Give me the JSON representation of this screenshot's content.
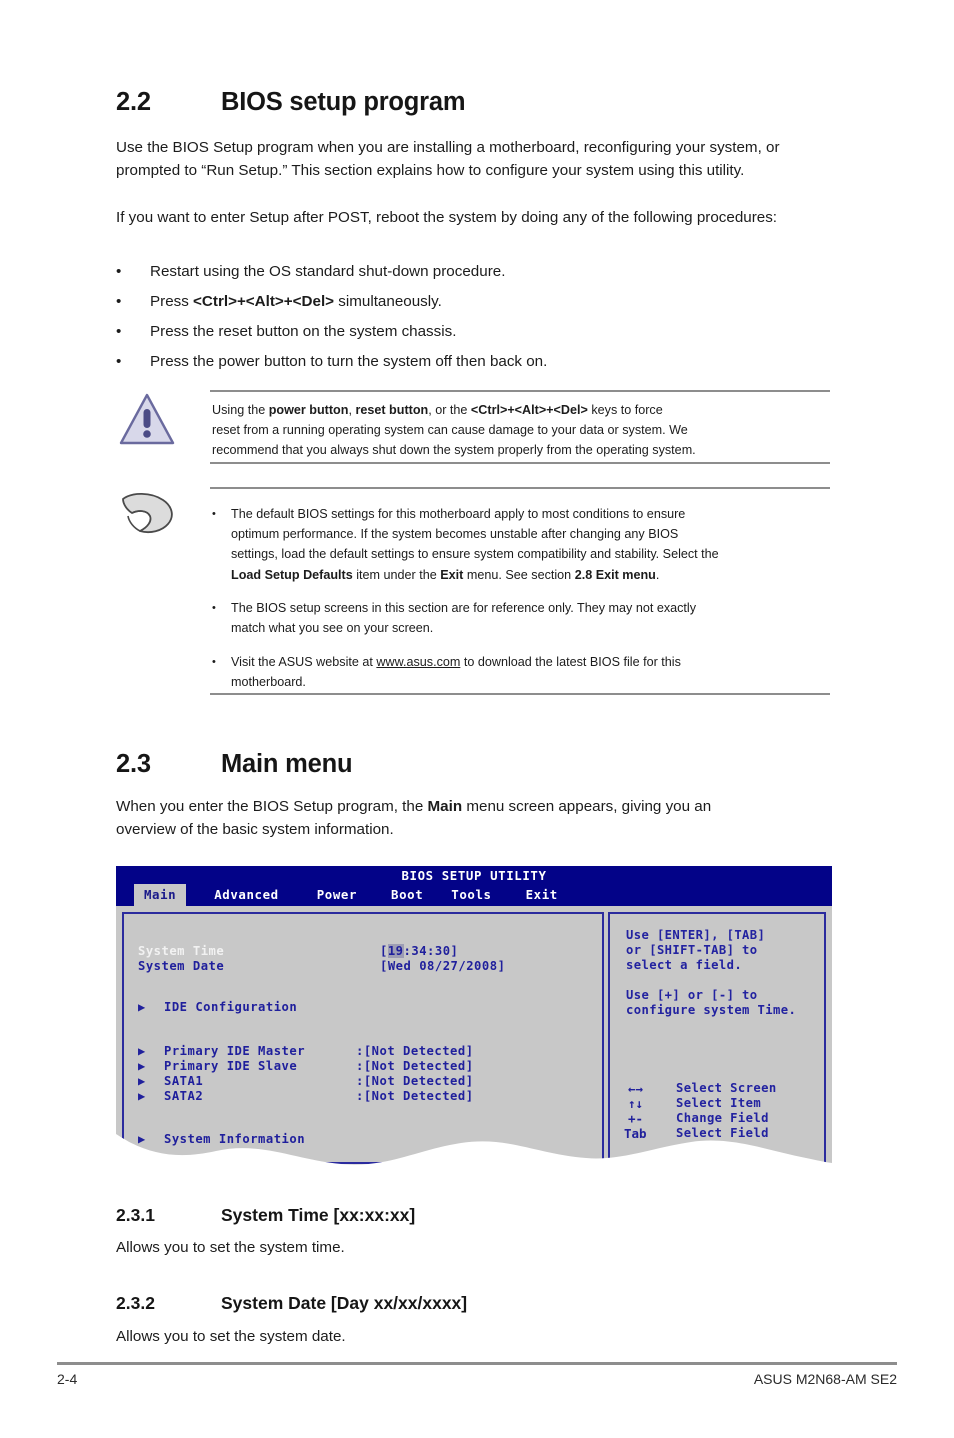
{
  "section_22": {
    "number": "2.2",
    "title": "BIOS setup program",
    "para1": "Use the BIOS Setup program when you are installing a motherboard, reconfiguring your system, or prompted to “Run Setup.” This section explains how to configure your system using this utility.",
    "para2": "If you want to enter Setup after POST, reboot the system by doing any of the following procedures:",
    "bullet_marker": "•",
    "bullets": [
      {
        "prefix": "Restart using the OS standard shut-down procedure.",
        "bold": "",
        "suffix": ""
      },
      {
        "prefix": "Press ",
        "bold": "<Ctrl>+<Alt>+<Del>",
        "suffix": " simultaneously."
      },
      {
        "prefix": "Press the reset button on the system chassis.",
        "bold": "",
        "suffix": ""
      },
      {
        "prefix": "Press the power button to turn the system off then back on.",
        "bold": "",
        "suffix": ""
      }
    ]
  },
  "warning_note": {
    "icon": "warning-triangle-icon",
    "line1_a": "Using the ",
    "line1_b": "power button",
    "line1_c": ", ",
    "line1_d": "reset button",
    "line1_e": ", or the ",
    "line1_f": "<Ctrl>+<Alt>+<Del>",
    "line1_g": " keys to force",
    "line2": "reset from a running operating system can cause damage to your data or system. We",
    "line3": "recommend that you always shut down the system properly from the operating system."
  },
  "info_note": {
    "icon": "pointing-hand-icon",
    "bullet_marker": "•",
    "items": [
      {
        "line1": "The default BIOS settings for this motherboard apply to most conditions to ensure",
        "line2": "optimum performance. If the system becomes unstable after changing any BIOS",
        "line3": "settings, load the default settings to ensure system compatibility and stability. Select the",
        "line4_a": "Load Setup Defaults",
        "line4_b": " item under the ",
        "line4_c": "Exit",
        "line4_d": " menu. See section ",
        "line4_e": "2.8 Exit menu",
        "line4_f": "."
      },
      {
        "line1": "The BIOS setup screens in this section are for reference only. They may not exactly",
        "line2": "match what you see on your screen."
      },
      {
        "line1_a": "Visit the ASUS website at ",
        "line1_link": "www.asus.com",
        "line1_b": " to download the latest BIOS file for this",
        "line2": "motherboard."
      }
    ]
  },
  "section_23": {
    "number": "2.3",
    "title": "Main menu",
    "para_a": "When you enter the BIOS Setup program, the ",
    "para_bold": "Main",
    "para_b": " menu screen appears, giving you an",
    "para_line2": "overview of the basic system information."
  },
  "bios_screen": {
    "title": "BIOS SETUP UTILITY",
    "tabs": [
      {
        "label": "Main",
        "active": true
      },
      {
        "label": "Advanced",
        "active": false
      },
      {
        "label": "Power",
        "active": false
      },
      {
        "label": "Boot",
        "active": false
      },
      {
        "label": "Tools",
        "active": false
      },
      {
        "label": "Exit",
        "active": false
      }
    ],
    "fields": [
      {
        "label": "System Time",
        "value_pre": "[",
        "value_hl": "19",
        "value_post": ":34:30]",
        "selected": true
      },
      {
        "label": "System Date",
        "value_pre": "[",
        "value_hl": "",
        "value_post": "Wed 08/27/2008]",
        "selected": false
      }
    ],
    "submenus": [
      {
        "marker": "▶",
        "label": "IDE Configuration",
        "value": ""
      }
    ],
    "devices": [
      {
        "marker": "▶",
        "label": "Primary IDE Master",
        "value": ":[Not Detected]"
      },
      {
        "marker": "▶",
        "label": "Primary IDE Slave",
        "value": ":[Not Detected]"
      },
      {
        "marker": "▶",
        "label": "SATA1",
        "value": ":[Not Detected]"
      },
      {
        "marker": "▶",
        "label": "SATA2",
        "value": ":[Not Detected]"
      }
    ],
    "sysinfo": {
      "marker": "▶",
      "label": "System Information"
    },
    "help": [
      "Use [ENTER], [TAB]",
      "or [SHIFT-TAB] to",
      "select a field.",
      "Use [+] or [-] to",
      "configure system Time."
    ],
    "legend": [
      {
        "keys": "←→",
        "action": "Select Screen"
      },
      {
        "keys": "↑↓",
        "action": "Select Item"
      },
      {
        "keys": "+-",
        "action": "Change Field"
      },
      {
        "keys": "Tab",
        "action": "Select Field"
      }
    ],
    "colors": {
      "header_blue": "#030388",
      "panel_gray": "#c8c8c8",
      "text_blue": "#1f1f9c",
      "selected_text": "#f2f2f2"
    }
  },
  "section_231": {
    "number": "2.3.1",
    "title": "System Time [xx:xx:xx]",
    "body": "Allows you to set the system time."
  },
  "section_232": {
    "number": "2.3.2",
    "title": "System Date [Day xx/xx/xxxx]",
    "body": "Allows you to set the system date."
  },
  "footer": {
    "page_number": "2-4",
    "product": "ASUS M2N68-AM SE2"
  }
}
